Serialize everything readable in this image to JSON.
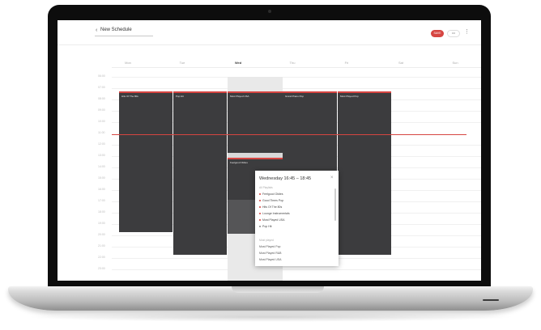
{
  "header": {
    "back_glyph": "‹",
    "title": "New Schedule",
    "save_label": "SAVE",
    "more_label": "•••",
    "menu_glyph": "⋮"
  },
  "colors": {
    "accent": "#d64541",
    "event_dark": "#3c3c3e",
    "today_column": "#e9e9e9"
  },
  "days": [
    "Mon",
    "Tue",
    "Wed",
    "Thu",
    "Fri",
    "Sat",
    "Sun"
  ],
  "times": [
    "06:00",
    "07:00",
    "08:00",
    "09:00",
    "10:00",
    "11:00",
    "12:00",
    "13:00",
    "14:00",
    "15:00",
    "16:00",
    "17:00",
    "18:00",
    "19:00",
    "20:00",
    "21:00",
    "22:00",
    "23:00"
  ],
  "events": [
    {
      "day": "Mon",
      "label": "Hits Of The 80s"
    },
    {
      "day": "Tue",
      "label": "Pop Hit"
    },
    {
      "day": "Wed",
      "label": "Most Played USA"
    },
    {
      "day": "Wed",
      "label": "Feelgood Oldies"
    },
    {
      "day": "Thu",
      "label": "Grand Piano Pop"
    },
    {
      "day": "Fri",
      "label": "Most Played Pop"
    }
  ],
  "popup": {
    "title": "Wednesday 16:45 – 18:45",
    "close_glyph": "×",
    "section_playlists": "All Playlists",
    "playlists": [
      {
        "name": "Feelgood Oldies",
        "active": true
      },
      {
        "name": "Good Times Pop",
        "active": true
      },
      {
        "name": "Hits Of The 80s",
        "active": true
      },
      {
        "name": "Lounge Instrumentals",
        "active": true
      },
      {
        "name": "Most Played USA",
        "active": true
      },
      {
        "name": "Pop Hit",
        "active": false
      }
    ],
    "section_recent": "Most played",
    "recent": [
      "Most Played Pop",
      "Most Played R&B",
      "Most Played USA"
    ]
  }
}
